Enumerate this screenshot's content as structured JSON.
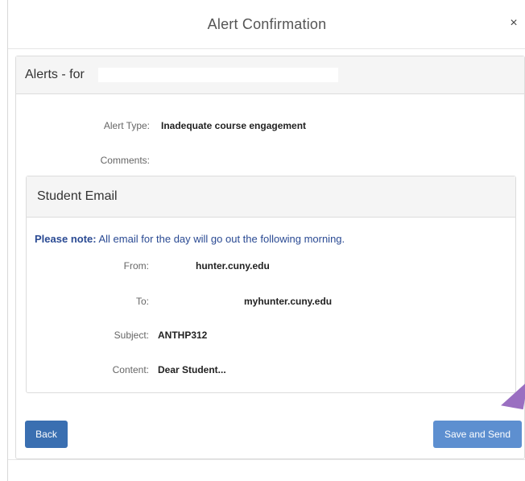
{
  "modal": {
    "title": "Alert Confirmation",
    "close_label": "×"
  },
  "alerts_panel": {
    "title": "Alerts - for",
    "alert_type_label": "Alert Type:",
    "alert_type_value": "Inadequate course engagement",
    "comments_label": "Comments:",
    "comments_value": ""
  },
  "email_panel": {
    "title": "Student Email",
    "note_bold": "Please note:",
    "note_text": " All email for the day will go out the following morning.",
    "from_label": "From:",
    "from_value": "hunter.cuny.edu",
    "to_label": "To:",
    "to_value": "myhunter.cuny.edu",
    "subject_label": "Subject:",
    "subject_value": "ANTHP312",
    "content_label": "Content:",
    "content_value": "Dear Student..."
  },
  "buttons": {
    "back": "Back",
    "save_send": "Save and Send"
  },
  "colors": {
    "primary_dark": "#3a6fb1",
    "primary_light": "#5d8fd0",
    "note_text": "#2a4a93",
    "cursor": "#9a6fc1"
  }
}
